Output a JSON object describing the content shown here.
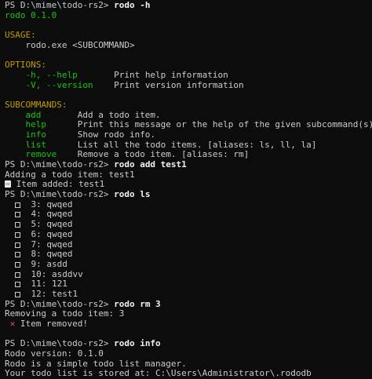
{
  "terminal": {
    "prompt": "PS D:\\mime\\todo-rs2> ",
    "help": {
      "command": "rodo -h",
      "version_line": "rodo 0.1.0",
      "usage_header": "USAGE:",
      "usage_line": "    rodo.exe <SUBCOMMAND>",
      "options_header": "OPTIONS:",
      "options": [
        {
          "flag": "    -h, --help       ",
          "desc": "Print help information"
        },
        {
          "flag": "    -V, --version    ",
          "desc": "Print version information"
        }
      ],
      "subcommands_header": "SUBCOMMANDS:",
      "subcommands": [
        {
          "name": "    add       ",
          "desc": "Add a todo item."
        },
        {
          "name": "    help      ",
          "desc": "Print this message or the help of the given subcommand(s)"
        },
        {
          "name": "    info      ",
          "desc": "Show rodo info."
        },
        {
          "name": "    list      ",
          "desc": "List all the todo items. [aliases: ls, ll, la]"
        },
        {
          "name": "    remove    ",
          "desc": "Remove a todo item. [aliases: rm]"
        }
      ]
    },
    "add": {
      "command": "rodo add test1",
      "output1": "Adding a todo item: test1",
      "output2": " Item added: test1"
    },
    "list": {
      "command": "rodo ls",
      "items": [
        {
          "num": "3",
          "text": "qwqed"
        },
        {
          "num": "4",
          "text": "qwqed"
        },
        {
          "num": "5",
          "text": "qwqed"
        },
        {
          "num": "6",
          "text": "qwqed"
        },
        {
          "num": "7",
          "text": "qwqed"
        },
        {
          "num": "8",
          "text": "qwqed"
        },
        {
          "num": "9",
          "text": "asdd"
        },
        {
          "num": "10",
          "text": "asddvv"
        },
        {
          "num": "11",
          "text": "121"
        },
        {
          "num": "12",
          "text": "test1"
        }
      ]
    },
    "remove": {
      "command": "rodo rm 3",
      "output1": "Removing a todo item: 3",
      "output2": " Item removed!"
    },
    "info": {
      "command": "rodo info",
      "lines": [
        "Rodo version: 0.1.0",
        "Rodo is a simple todo list manager.",
        "Your todo list is stored at: C:\\Users\\Administrator\\.rododb"
      ]
    },
    "colors": {
      "background": "#0c0c0c",
      "text": "#cccccc",
      "green": "#16c60c",
      "orange": "#c19c00",
      "red": "#e74856"
    }
  }
}
